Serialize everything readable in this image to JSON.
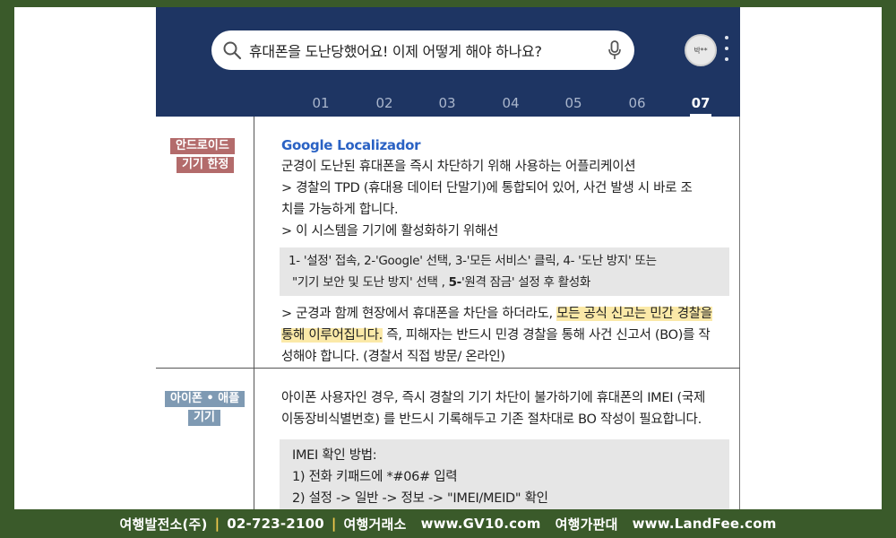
{
  "search": {
    "query": "휴대폰을 도난당했어요! 이제 어떻게 해야 하나요?"
  },
  "header": {
    "avatar_label": "박**",
    "tabs": [
      "01",
      "02",
      "03",
      "04",
      "05",
      "06",
      "07"
    ],
    "active_tab": "07"
  },
  "android": {
    "badge_line1": "안드로이드",
    "badge_line2": "기기 한정",
    "title": "Google Localizador",
    "desc": "군경이 도난된 휴대폰을 즉시 차단하기 위해 사용하는 어플리케이션",
    "line2": "> 경찰의 TPD (휴대용 데이터 단말기)에 통합되어 있어, 사건 발생 시 바로 조",
    "line3": "치를 가능하게 합니다.",
    "line4": "> 이 시스템을 기기에 활성화하기 위해선",
    "steps_line1": "1- '설정' 접속,  2-'Google' 선택, 3-'모든 서비스' 클릭,  4- '도난 방지' 또는",
    "steps_line2a": "\"기기 보안 및 도난 방지' 선택 ,  ",
    "steps_line2b": "5-",
    "steps_line2c": "'원격 잠금' 설정 후 활성화",
    "note_a": "> 군경과 함께 현장에서 휴대폰을 차단을 하더라도, ",
    "note_hl1": "모든 공식 신고는 민간 경찰을",
    "note_hl2": "통해 이루어집니다.",
    "note_b": "  즉,  피해자는 반드시 민경 경찰을 통해 사건 신고서 (BO)를 작",
    "note_c": "성해야 합니다. (경찰서 직접 방문/ 온라인)"
  },
  "iphone": {
    "badge_line1": "아이폰 • 애플",
    "badge_line2": "기기",
    "line1": "아이폰 사용자인 경우, 즉시 경찰의 기기 차단이 불가하기에  휴대폰의 IMEI (국제",
    "line2": "이동장비식별번호) 를 반드시 기록해두고 기존 절차대로 BO 작성이 필요합니다.",
    "box_line1": "IMEI 확인 방법:",
    "box_line2": "1) 전화 키패드에 *#06# 입력",
    "box_line3": "2) 설정 -> 일반 -> 정보 -> \"IMEI/MEID\" 확인"
  },
  "footer": {
    "company": "여행발전소(주)",
    "phone": "02-723-2100",
    "label1": "여행거래소",
    "site1": "www.GV10.com",
    "label2": "여행가판대",
    "site2": "www.LandFee.com"
  },
  "colors": {
    "header_bg": "#1e3563",
    "page_bg": "#3a5a2a",
    "title_blue": "#2a62c4",
    "highlight": "#fbe9a8",
    "badge_red": "#b36b6b",
    "badge_blue": "#7f9ab3"
  },
  "icons": [
    "search-icon",
    "mic-icon",
    "more-vert-icon"
  ]
}
